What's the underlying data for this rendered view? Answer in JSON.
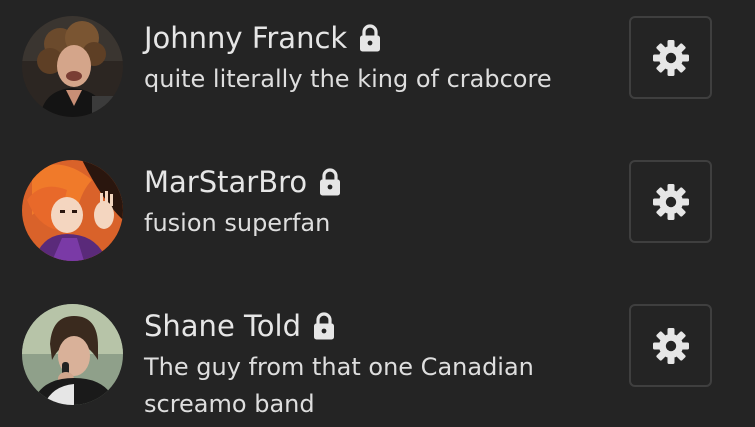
{
  "members": [
    {
      "name": "Johnny Franck",
      "bio": "quite literally the king of crabcore",
      "avatar_icon": "avatar-photo-johnny-franck",
      "status_icon": "lock-icon",
      "action_icon": "gear-icon"
    },
    {
      "name": "MarStarBro",
      "bio": "fusion superfan",
      "avatar_icon": "avatar-drawing-marstarbro",
      "status_icon": "lock-icon",
      "action_icon": "gear-icon"
    },
    {
      "name": "Shane Told",
      "bio": "The guy from that one Canadian screamo band",
      "avatar_icon": "avatar-photo-shane-told",
      "status_icon": "lock-icon",
      "action_icon": "gear-icon"
    }
  ],
  "colors": {
    "background": "#242424",
    "text": "#e6e6e6",
    "button_border": "#3f3f3f",
    "icon": "#e6e6e6"
  }
}
